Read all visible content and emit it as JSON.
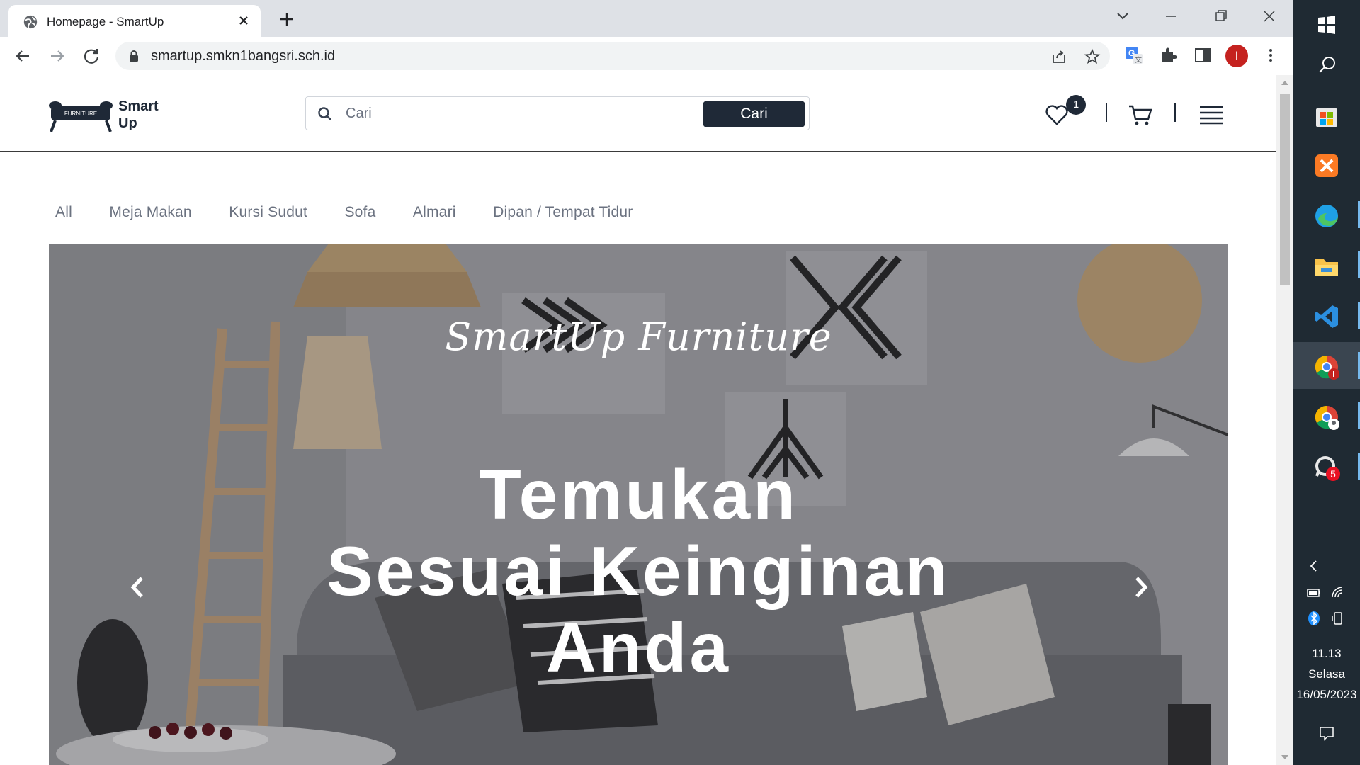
{
  "browser": {
    "tab_title": "Homepage - SmartUp",
    "url": "smartup.smkn1bangsri.sch.id",
    "profile_initial": "I"
  },
  "site": {
    "logo_text": "Smart Up",
    "logo_badge": "FURNITURE",
    "search_placeholder": "Cari",
    "search_button": "Cari",
    "wishlist_count": "1",
    "categories": [
      "All",
      "Meja Makan",
      "Kursi Sudut",
      "Sofa",
      "Almari",
      "Dipan / Tempat Tidur"
    ],
    "hero": {
      "kicker": "SmartUp Furniture",
      "title_lines": [
        "Temukan",
        "Sesuai Keinginan",
        "Anda"
      ]
    }
  },
  "taskbar": {
    "time": "11.13",
    "day": "Selasa",
    "date": "16/05/2023",
    "whatsapp_badge": "5"
  },
  "colors": {
    "primary": "#1f2937",
    "tab_strip": "#dee1e6",
    "taskbar": "#1f2a33"
  }
}
